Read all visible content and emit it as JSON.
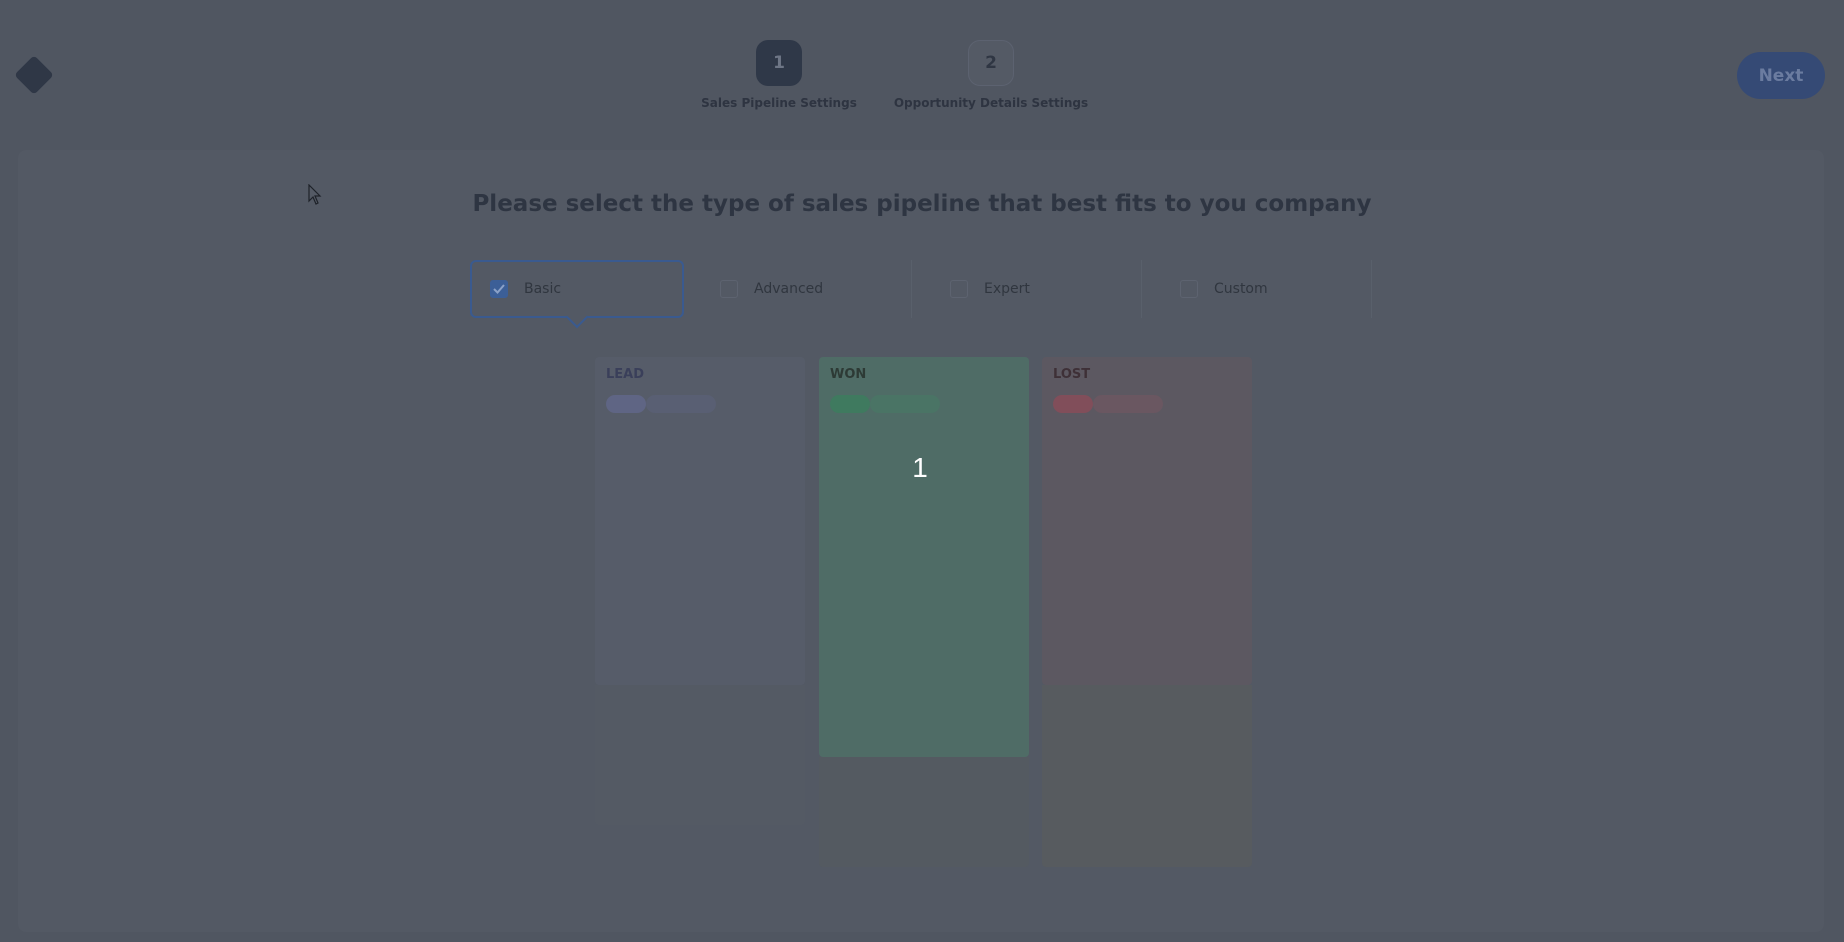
{
  "header": {
    "steps": [
      {
        "number": "1",
        "label": "Sales Pipeline Settings"
      },
      {
        "number": "2",
        "label": "Opportunity Details Settings"
      }
    ],
    "next_label": "Next"
  },
  "main": {
    "heading": "Please select the type of sales pipeline that best fits to you company",
    "options": [
      {
        "label": "Basic",
        "checked": true
      },
      {
        "label": "Advanced",
        "checked": false
      },
      {
        "label": "Expert",
        "checked": false
      },
      {
        "label": "Custom",
        "checked": false
      }
    ],
    "columns": [
      {
        "title": "LEAD"
      },
      {
        "title": "WON"
      },
      {
        "title": "LOST"
      }
    ],
    "overlay_number": "1"
  },
  "colors": {
    "accent": "#3a5a8f",
    "won": "#3f7a5f",
    "lost": "#814e5a",
    "lead": "#5f6584"
  }
}
